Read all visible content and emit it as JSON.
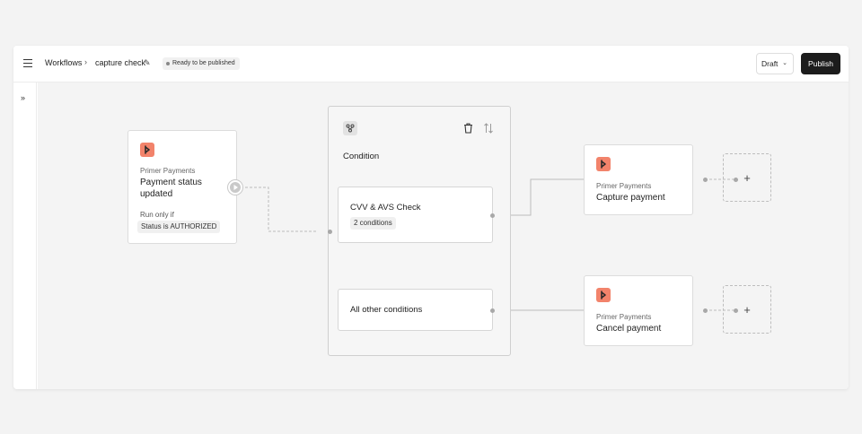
{
  "header": {
    "breadcrumb_root": "Workflows",
    "breadcrumb_separator": "›",
    "workflow_name": "capture check",
    "status_badge": "Ready to be published",
    "draft_label": "Draft",
    "publish_label": "Publish"
  },
  "trigger_node": {
    "app_name": "Primer Payments",
    "title_line1": "Payment status",
    "title_line2": "updated",
    "run_only_if_label": "Run only if",
    "condition_chip": "Status is AUTHORIZED",
    "icon": "primer-logo-icon"
  },
  "condition_group": {
    "title": "Condition",
    "icon": "branch-icon",
    "branches": [
      {
        "label": "CVV & AVS Check",
        "chip": "2 conditions"
      },
      {
        "label": "All other conditions"
      }
    ]
  },
  "action_nodes": [
    {
      "app_name": "Primer Payments",
      "title": "Capture payment",
      "icon": "primer-logo-icon"
    },
    {
      "app_name": "Primer Payments",
      "title": "Cancel payment",
      "icon": "primer-logo-icon"
    }
  ],
  "colors": {
    "accent": "#f2836b",
    "publish_button": "#1c1c1c",
    "canvas": "#f4f4f4"
  }
}
